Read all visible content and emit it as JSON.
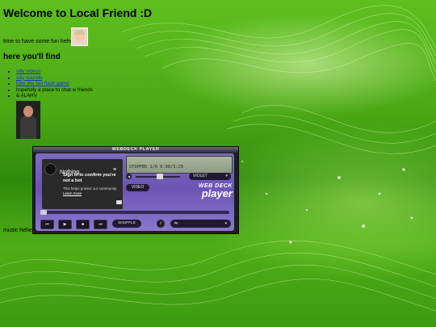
{
  "page": {
    "title": "Welcome to Local Friend :D",
    "subtitle": "time to have some fun hehe",
    "section_heading": "here you'll find",
    "list": [
      {
        "label": "silly videos",
        "link": true
      },
      {
        "label": "silly sounds",
        "link": true
      },
      {
        "label": "hide the fart flash game",
        "link": true
      },
      {
        "label": "hopefully a place to chat w friends",
        "link": false
      },
      {
        "label": "& #LAHV",
        "link": false
      }
    ],
    "music_label": "music hehe"
  },
  "player": {
    "title": "WEBDECK PLAYER",
    "embed": {
      "track": "Nothing",
      "menu_icon": "≡",
      "signin_title": "Sign in to confirm you're not a bot",
      "signin_note": "This helps protect our community.",
      "learn_more": "Learn more"
    },
    "lcd_text": "STOPPED 1/6 0:00/3:29",
    "skin": "VIOLET",
    "video_label": "VIDEO",
    "logo_line1": "WEB DECK",
    "logo_line2": "player",
    "progress_fraction": 0,
    "controls": {
      "prev": "⏮",
      "play": "▶",
      "stop": "■",
      "next": "⏭",
      "shuffle": "SHUFFLE",
      "info": "i",
      "playlist": "⇆",
      "chevron": "▾"
    }
  },
  "colors": {
    "link": "#1a2bd8",
    "player_body": "#7d6cc0",
    "lcd": "#a9b59d"
  }
}
